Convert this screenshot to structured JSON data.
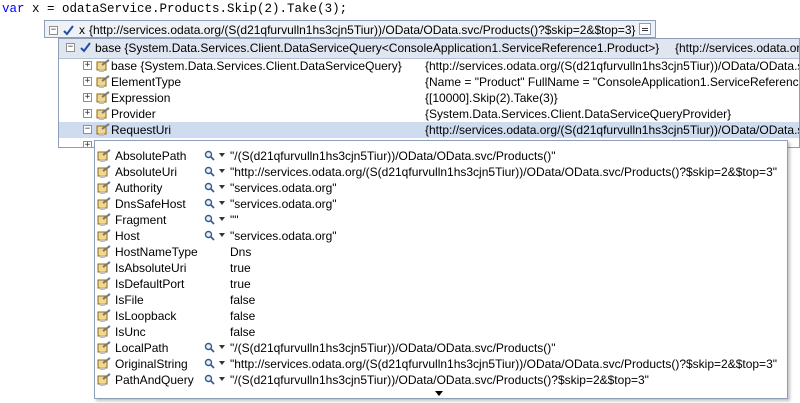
{
  "code": {
    "keyword": "var",
    "rest": " x = odataService.Products.Skip(2).Take(3);"
  },
  "tip1": {
    "name": "x",
    "value": "{http://services.odata.org/(S(d21qfurvulln1hs3cjn5Tiur))/OData/OData.svc/Products()?$skip=2&$top=3}"
  },
  "tip2": {
    "header": {
      "name": "base {System.Data.Services.Client.DataServiceQuery<ConsoleApplication1.ServiceReference1.Product>}",
      "value": "{http://services.odata.or"
    },
    "rows": [
      {
        "name": "base {System.Data.Services.Client.DataServiceQuery}",
        "value": "{http://services.odata.org/(S(d21qfurvulln1hs3cjn5Tiur))/OData/OData.s"
      },
      {
        "name": "ElementType",
        "value": "{Name = \"Product\" FullName = \"ConsoleApplication1.ServiceReference"
      },
      {
        "name": "Expression",
        "value": "{[10000].Skip(2).Take(3)}"
      },
      {
        "name": "Provider",
        "value": "{System.Data.Services.Client.DataServiceQueryProvider}"
      },
      {
        "name": "RequestUri",
        "value": "{http://services.odata.org/(S(d21qfurvulln1hs3cjn5Tiur))/OData/OData.s"
      }
    ]
  },
  "tip3": {
    "rows": [
      {
        "name": "AbsolutePath",
        "value": "\"/(S(d21qfurvulln1hs3cjn5Tiur))/OData/OData.svc/Products()\""
      },
      {
        "name": "AbsoluteUri",
        "value": "\"http://services.odata.org/(S(d21qfurvulln1hs3cjn5Tiur))/OData/OData.svc/Products()?$skip=2&$top=3\""
      },
      {
        "name": "Authority",
        "value": "\"services.odata.org\""
      },
      {
        "name": "DnsSafeHost",
        "value": "\"services.odata.org\""
      },
      {
        "name": "Fragment",
        "value": "\"\""
      },
      {
        "name": "Host",
        "value": "\"services.odata.org\""
      },
      {
        "name": "HostNameType",
        "value": "Dns"
      },
      {
        "name": "IsAbsoluteUri",
        "value": "true"
      },
      {
        "name": "IsDefaultPort",
        "value": "true"
      },
      {
        "name": "IsFile",
        "value": "false"
      },
      {
        "name": "IsLoopback",
        "value": "false"
      },
      {
        "name": "IsUnc",
        "value": "false"
      },
      {
        "name": "LocalPath",
        "value": "\"/(S(d21qfurvulln1hs3cjn5Tiur))/OData/OData.svc/Products()\""
      },
      {
        "name": "OriginalString",
        "value": "\"http://services.odata.org/(S(d21qfurvulln1hs3cjn5Tiur))/OData/OData.svc/Products()?$skip=2&$top=3\""
      },
      {
        "name": "PathAndQuery",
        "value": "\"/(S(d21qfurvulln1hs3cjn5Tiur))/OData/OData.svc/Products()?$skip=2&$top=3\""
      }
    ]
  }
}
